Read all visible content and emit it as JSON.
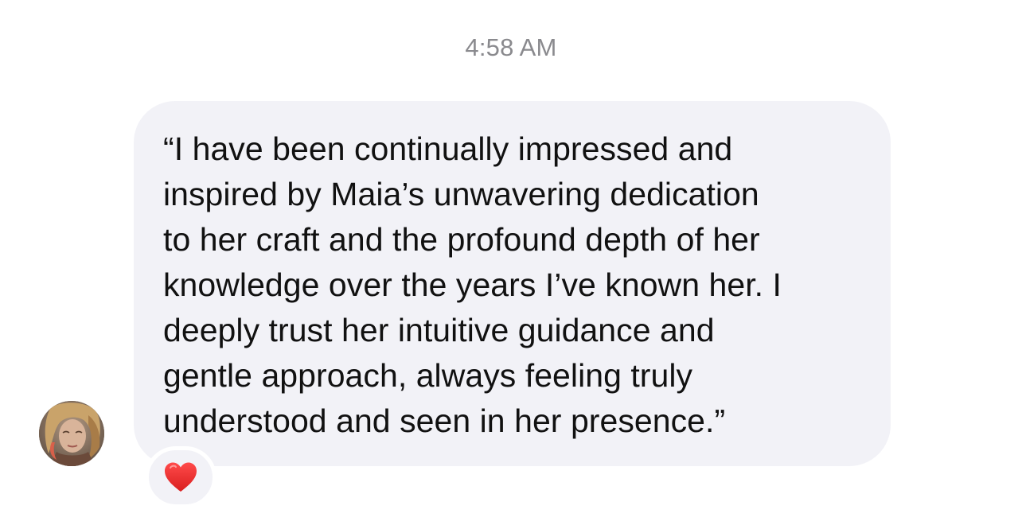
{
  "thread": {
    "timestamp": "4:58 AM"
  },
  "message": {
    "text": "“I have been continually impressed and\ninspired by Maia’s unwavering dedication\nto her craft and the profound depth of her\nknowledge over the years I’ve known her. I\ndeeply trust her intuitive guidance and\ngentle approach, always feeling truly\nunderstood and seen in her presence.”",
    "bubble_color": "#f2f2f7",
    "reaction_icon": "red-heart"
  },
  "sender": {
    "avatar_icon": "sender-avatar"
  }
}
